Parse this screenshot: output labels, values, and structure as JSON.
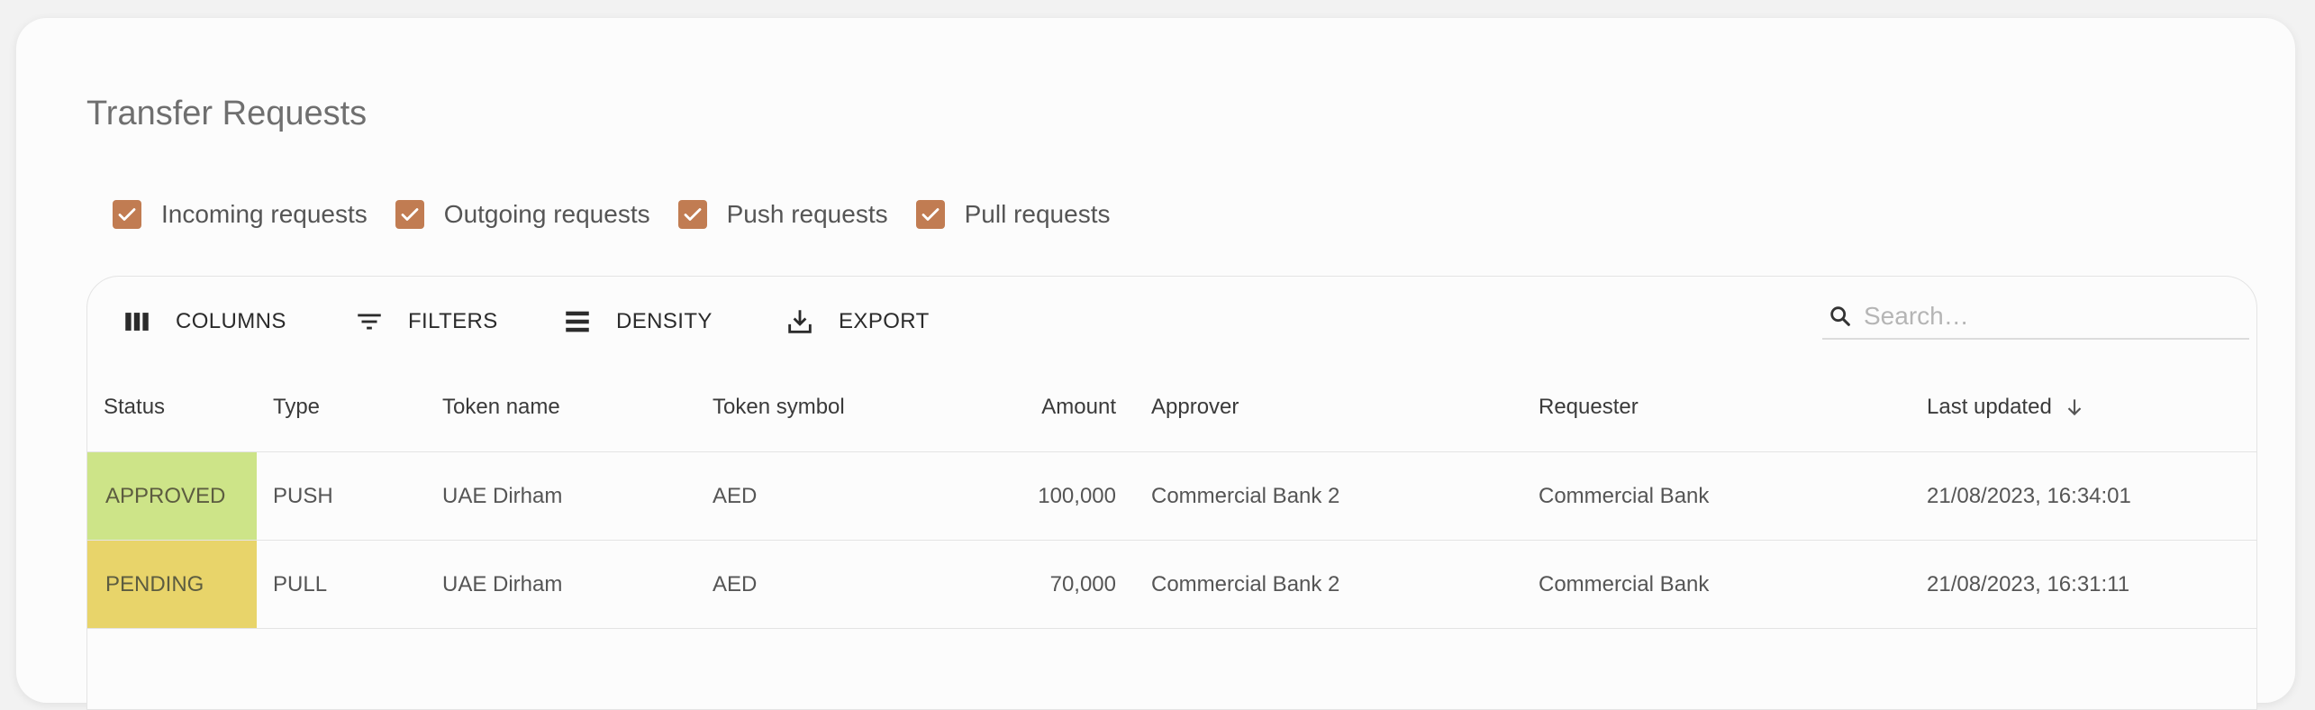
{
  "page": {
    "title": "Transfer Requests"
  },
  "filters": [
    {
      "label": "Incoming requests",
      "checked": true
    },
    {
      "label": "Outgoing requests",
      "checked": true
    },
    {
      "label": "Push requests",
      "checked": true
    },
    {
      "label": "Pull requests",
      "checked": true
    }
  ],
  "colors": {
    "checkbox": "#c17c52",
    "approved": "#cde488",
    "pending": "#e8d46a"
  },
  "toolbar": {
    "columns_label": "COLUMNS",
    "filters_label": "FILTERS",
    "density_label": "DENSITY",
    "export_label": "EXPORT",
    "search_placeholder": "Search…"
  },
  "table": {
    "columns": [
      "Status",
      "Type",
      "Token name",
      "Token symbol",
      "Amount",
      "Approver",
      "Requester",
      "Last updated"
    ],
    "sort": {
      "column": "Last updated",
      "direction": "desc"
    },
    "rows": [
      {
        "status": "APPROVED",
        "type": "PUSH",
        "token_name": "UAE Dirham",
        "token_symbol": "AED",
        "amount": "100,000",
        "approver": "Commercial Bank 2",
        "requester": "Commercial Bank",
        "last_updated": "21/08/2023, 16:34:01"
      },
      {
        "status": "PENDING",
        "type": "PULL",
        "token_name": "UAE Dirham",
        "token_symbol": "AED",
        "amount": "70,000",
        "approver": "Commercial Bank 2",
        "requester": "Commercial Bank",
        "last_updated": "21/08/2023, 16:31:11"
      }
    ]
  }
}
